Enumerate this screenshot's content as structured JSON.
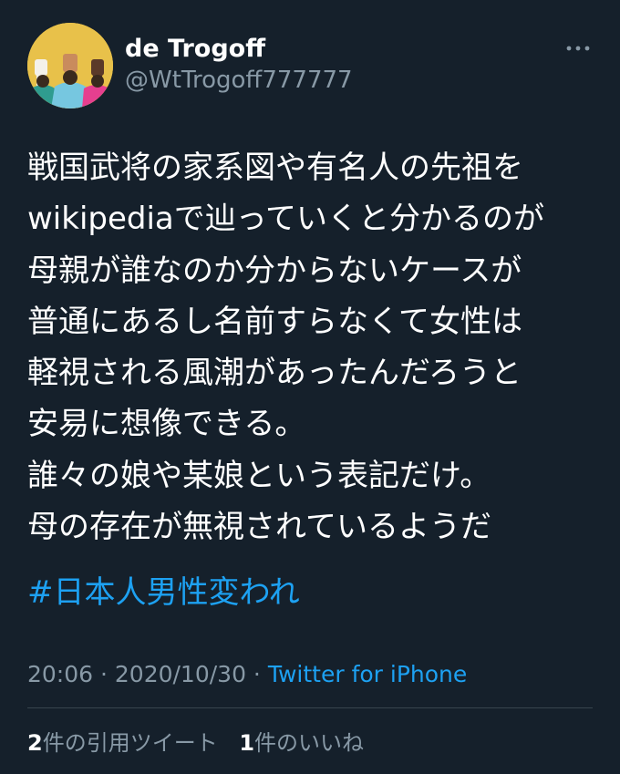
{
  "user": {
    "display_name": "de Trogoff",
    "handle": "@WtTrogoff777777"
  },
  "tweet": {
    "lines": [
      "戦国武将の家系図や有名人の先祖を",
      "wikipediaで辿っていくと分かるのが",
      "母親が誰なのか分からないケースが",
      "普通にあるし名前すらなくて女性は",
      "軽視される風潮があったんだろうと",
      "安易に想像できる。",
      "誰々の娘や某娘という表記だけ。",
      "母の存在が無視されているようだ"
    ],
    "hashtag": "#日本人男性変われ"
  },
  "meta": {
    "time": "20:06",
    "separator1": " · ",
    "date": "2020/10/30",
    "separator2": " · ",
    "source": "Twitter for iPhone"
  },
  "stats": {
    "quote_count": "2",
    "quote_label": "件の引用ツイート",
    "like_count": "1",
    "like_label": "件のいいね"
  },
  "colors": {
    "background": "#15202b",
    "text": "#ffffff",
    "secondary": "#8899a6",
    "accent": "#1da1f2",
    "divider": "#38444d",
    "avatar_bg": "#e8c14a"
  },
  "icons": {
    "more": "more-horizontal-icon",
    "avatar": "raised-fists-avatar"
  }
}
